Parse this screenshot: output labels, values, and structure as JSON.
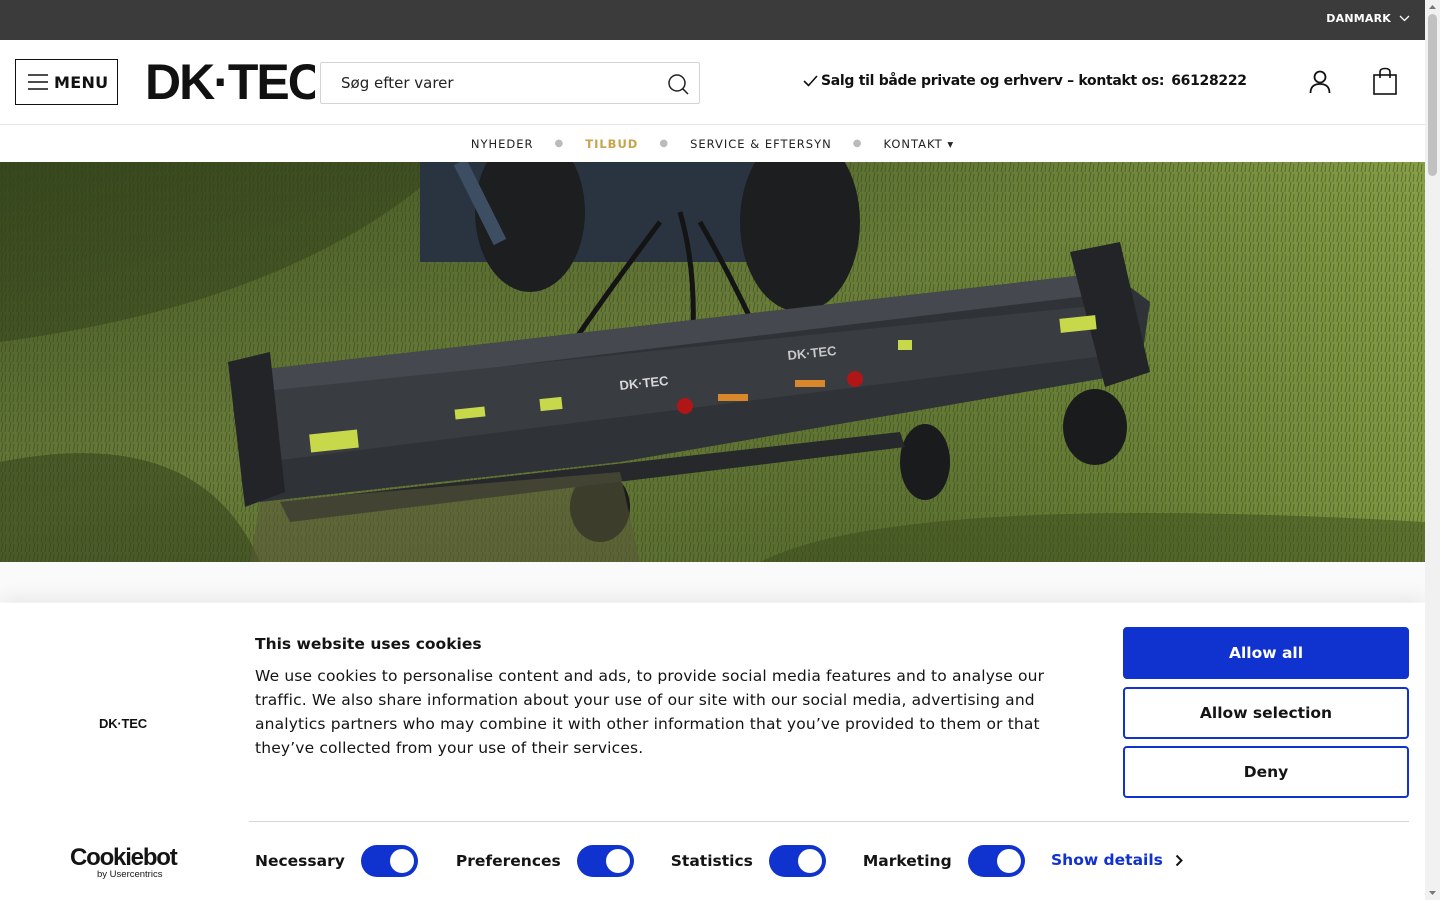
{
  "topbar": {
    "country": "DANMARK"
  },
  "header": {
    "menu_label": "MENU",
    "logo_text": "DK·TEC",
    "search_placeholder": "Søg efter varer",
    "usp_text": "Salg til både private og erhverv – kontakt os:",
    "usp_phone": "66128222"
  },
  "nav": {
    "items": [
      {
        "label": "NYHEDER"
      },
      {
        "label": "TILBUD"
      },
      {
        "label": "SERVICE & EFTERSYN"
      },
      {
        "label": "KONTAKT ▾"
      }
    ],
    "highlight_color": "#c9a24b"
  },
  "cookie_banner": {
    "logo_text": "DK·TEC",
    "title": "This website uses cookies",
    "text": "We use cookies to personalise content and ads, to provide social media features and to analyse our traffic. We also share information about your use of our site with our social media, advertising and analytics partners who may combine it with other information that you’ve provided to them or that they’ve collected from your use of their services.",
    "buttons": {
      "allow_all": "Allow all",
      "allow_selection": "Allow selection",
      "deny": "Deny"
    },
    "toggles": [
      {
        "label": "Necessary",
        "on": true
      },
      {
        "label": "Preferences",
        "on": true
      },
      {
        "label": "Statistics",
        "on": true
      },
      {
        "label": "Marketing",
        "on": true
      }
    ],
    "show_details": "Show details",
    "brand": "Cookiebot",
    "brand_sub": "by Usercentrics",
    "accent_color": "#1032cf"
  }
}
